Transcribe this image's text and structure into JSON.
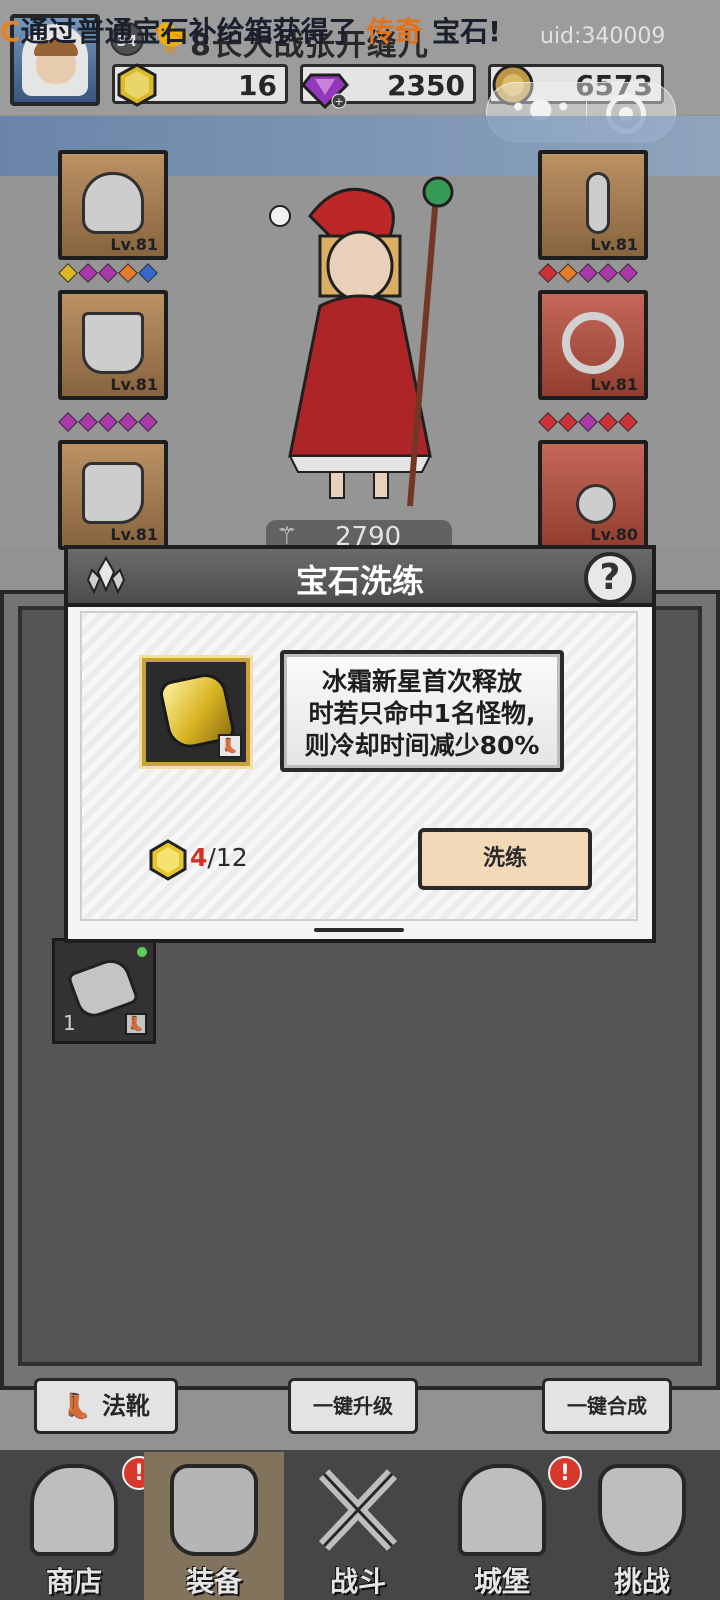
{
  "header": {
    "level": "34",
    "player_name": "8长大战张开缝儿",
    "uid": "uid:340009",
    "resources": {
      "gold_gem": "16",
      "purple_gem": "2350",
      "coin": "6573"
    }
  },
  "notice": {
    "prefix": "C",
    "text_before": "通过普通宝石补给箱获得了",
    "highlight": "传奇",
    "text_after": "宝石!"
  },
  "equipment": {
    "left_slots": [
      {
        "level": "Lv.81"
      },
      {
        "level": "Lv.81"
      },
      {
        "level": "Lv.81"
      }
    ],
    "right_slots": [
      {
        "level": "Lv.81"
      },
      {
        "level": "Lv.81"
      },
      {
        "level": "Lv.80"
      }
    ],
    "combat_power": "2790",
    "colors": {
      "purple_gem": "#b53bb5",
      "orange_gem": "#f0832c",
      "red_gem": "#d8333a",
      "blue_gem": "#3a6fd8",
      "yellow_gem": "#e8c02a"
    }
  },
  "modal": {
    "title": "宝石洗练",
    "help_label": "?",
    "description": "冰霜新星首次释放时若只命中1名怪物，则冷却时间减少80%",
    "desc_line1": "冰霜新星首次释放",
    "desc_line2": "时若只命中1名怪物,",
    "desc_line3": "则冷却时间减少80%",
    "cost_have": "4",
    "cost_need": "/12",
    "refine_label": "洗练"
  },
  "inventory": {
    "item_count": "1"
  },
  "actions": {
    "boot_label": "法靴",
    "upgrade_all_label": "一键升级",
    "merge_all_label": "一键合成"
  },
  "nav": {
    "items": [
      {
        "label": "商店",
        "alert": "!"
      },
      {
        "label": "装备"
      },
      {
        "label": "战斗"
      },
      {
        "label": "城堡",
        "alert": "!"
      },
      {
        "label": "挑战"
      }
    ]
  },
  "icons": {
    "more": "more-dots-icon",
    "close": "close-target-icon"
  }
}
